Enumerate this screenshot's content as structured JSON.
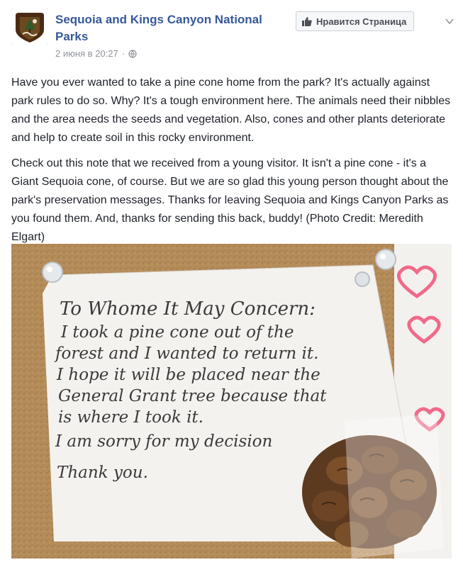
{
  "post": {
    "page_name": "Sequoia and Kings Canyon National Parks",
    "timestamp": "2 июня в 20:27",
    "privacy_icon": "globe-icon",
    "like_page_label": "Нравится Страница",
    "paragraphs": [
      "Have you ever wanted to take a pine cone home from the park? It's actually against park rules to do so. Why? It's a tough environment here. The animals need their nibbles and the area needs the seeds and vegetation. Also, cones and other plants deteriorate and help to create soil in this rocky environment.",
      "Check out this note that we received from a young visitor. It isn't a pine cone - it's a Giant Sequoia cone, of course. But we are so glad this young person thought about the park's preservation messages. Thanks for leaving Sequoia and Kings Canyon Parks as you found them. And, thanks for sending this back, buddy! (Photo Credit: Meredith Elgart)"
    ]
  },
  "note": {
    "lines": [
      "To Whome It May Concern:",
      "I took a pine cone out of the",
      "forest and I wanted to return it.",
      "I hope it will be placed near the",
      "General Grant tree because that",
      "is where I took it.",
      "I am sorry for my decision",
      "Thank you."
    ]
  },
  "colors": {
    "link": "#365899",
    "text": "#1d2129",
    "meta": "#90949c",
    "corkboard": "#b7915f",
    "heart": "#f06a8a"
  }
}
